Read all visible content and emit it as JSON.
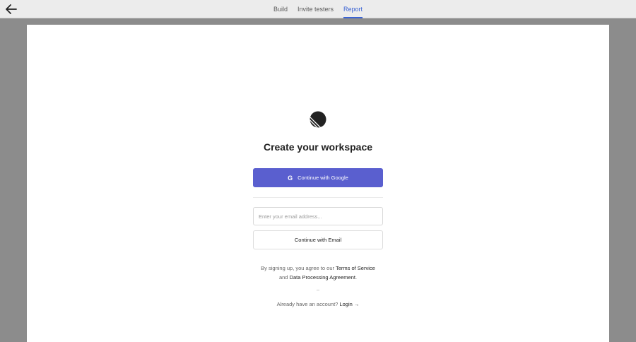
{
  "topbar": {
    "back_icon": "arrow-left-icon",
    "tabs": [
      {
        "label": "Build",
        "active": false
      },
      {
        "label": "Invite testers",
        "active": false
      },
      {
        "label": "Report",
        "active": true
      }
    ]
  },
  "colors": {
    "accent": "#3b63d3",
    "primary_button": "#5a5fcf",
    "backdrop": "#8c8c8c"
  },
  "main": {
    "logo_icon": "linear-logo-icon",
    "title": "Create your workspace",
    "google_button": {
      "icon": "google-g-icon",
      "icon_glyph": "G",
      "label": "Continue with Google"
    },
    "email_input": {
      "placeholder": "Enter your email address...",
      "value": ""
    },
    "email_button_label": "Continue with Email",
    "terms": {
      "prefix": "By signing up, you agree to our",
      "terms_link": "Terms of Service",
      "and_text": "and",
      "dpa_link": "Data Processing Agreement",
      "suffix": "."
    },
    "separator": "–",
    "login": {
      "prompt": "Already have an account?",
      "link": "Login →"
    }
  }
}
